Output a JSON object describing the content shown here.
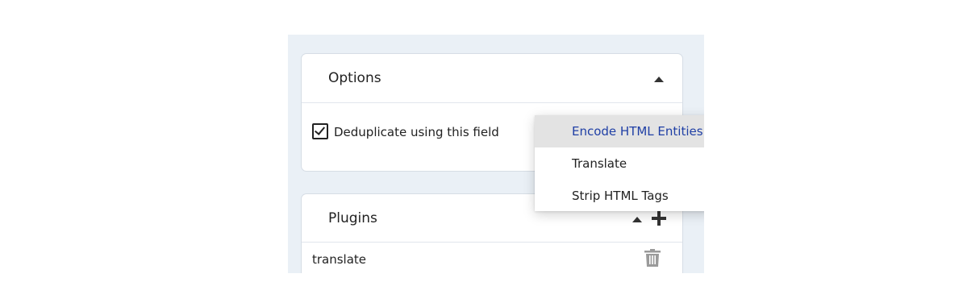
{
  "options": {
    "title": "Options",
    "dedupe_label": "Deduplicate using this field",
    "dedupe_checked": true
  },
  "dropdown": {
    "items": [
      {
        "label": "Encode HTML Entities",
        "highlighted": true
      },
      {
        "label": "Translate",
        "highlighted": false
      },
      {
        "label": "Strip HTML Tags",
        "highlighted": false
      }
    ]
  },
  "plugins": {
    "title": "Plugins",
    "rows": [
      {
        "label": "translate"
      }
    ]
  },
  "colors": {
    "panel_bg": "#eaf0f6",
    "highlight_text": "#1f3fa5",
    "highlight_bg": "#e3e3e3",
    "trash_icon": "#9a9a9a"
  },
  "icons": [
    "caret-up-icon",
    "plus-icon",
    "trash-icon",
    "checkbox-checked-icon"
  ]
}
